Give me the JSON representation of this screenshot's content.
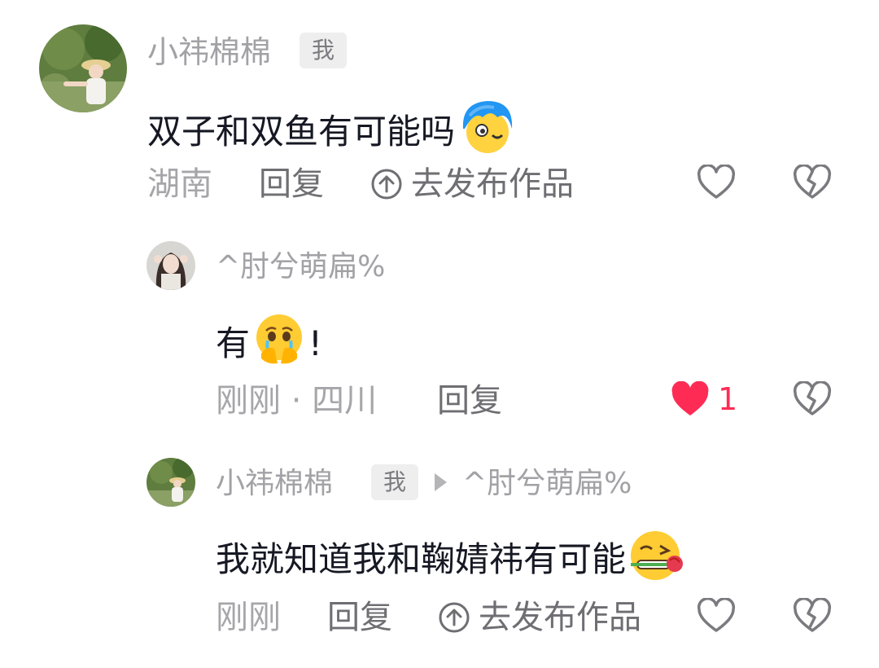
{
  "comments": [
    {
      "author": "小祎棉棉",
      "me_badge": "我",
      "text": "双子和双鱼有可能吗",
      "emoji": "peeking-face-emoji",
      "location": "湖南",
      "reply_label": "回复",
      "publish_label": "去发布作品"
    },
    {
      "author": "^肘兮萌扁%",
      "text_before": "有",
      "emoji": "crying-hands-emoji",
      "text_after": "!",
      "time_location": "刚刚 · 四川",
      "reply_label": "回复",
      "likes": "1",
      "liked": true
    },
    {
      "author": "小祎棉棉",
      "me_badge": "我",
      "reply_to": "^肘兮萌扁%",
      "text": "我就知道我和鞠婧祎有可能",
      "emoji": "rose-wink-emoji",
      "time": "刚刚",
      "reply_label": "回复",
      "publish_label": "去发布作品"
    }
  ],
  "colors": {
    "like_red": "#fe2c55",
    "icon_gray": "#7a7a7f",
    "text_dark": "#161823",
    "meta_gray": "#a6a6aa"
  }
}
